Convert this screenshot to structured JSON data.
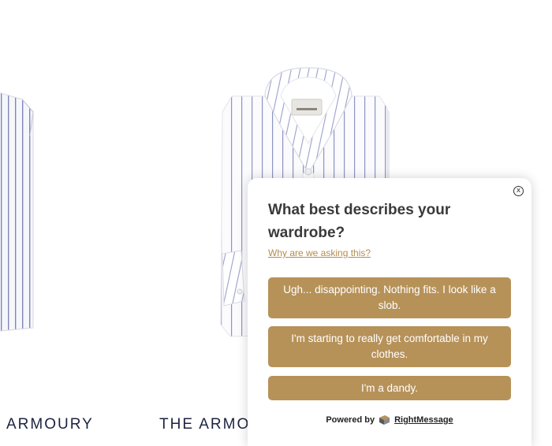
{
  "brand_labels": {
    "left": "ARMOURY",
    "middle": "THE ARMOU"
  },
  "popup": {
    "close_symbol": "x",
    "question": "What best describes your wardrobe?",
    "why_link": "Why are we asking this?",
    "answers": [
      "Ugh... disappointing. Nothing fits. I look like a slob.",
      "I'm starting to really get comfortable in my clothes.",
      "I'm a dandy."
    ],
    "powered_by": "Powered by",
    "provider": "RightMessage",
    "provider_icon": "rightmessage-logo-icon"
  },
  "colors": {
    "button_bg": "#b69259",
    "link": "#b38d4f",
    "brand_text": "#1c2340"
  }
}
